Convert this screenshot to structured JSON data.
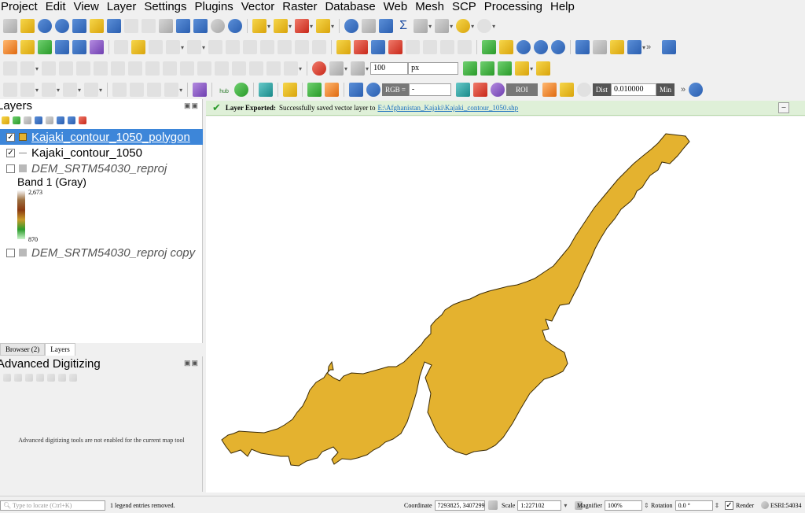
{
  "menu": [
    "Project",
    "Edit",
    "View",
    "Layer",
    "Settings",
    "Plugins",
    "Vector",
    "Raster",
    "Database",
    "Web",
    "Mesh",
    "SCP",
    "Processing",
    "Help"
  ],
  "toolbar3": {
    "buffer_value": "100",
    "unit": "px"
  },
  "toolbar4": {
    "hub_label": "hub",
    "rgb_label": "RGB =",
    "rgb_value": "-",
    "roi_label": "ROI",
    "dist_label": "Dist",
    "dist_value": "0.010000",
    "min_label": "Min"
  },
  "layers_panel": {
    "title": "Layers",
    "layers": [
      {
        "name": "Kajaki_contour_1050_polygon",
        "checked": true,
        "selected": true,
        "symbol": "polygon"
      },
      {
        "name": "Kajaki_contour_1050",
        "checked": true,
        "selected": false,
        "symbol": "line"
      },
      {
        "name": "DEM_SRTM54030_reproj",
        "checked": false,
        "selected": false,
        "symbol": "raster"
      },
      {
        "name": "DEM_SRTM54030_reproj copy",
        "checked": false,
        "selected": false,
        "symbol": "raster"
      }
    ],
    "band_label": "Band 1 (Gray)",
    "ramp_max": "2,673",
    "ramp_min": "870"
  },
  "tabs": [
    "Browser (2)",
    "Layers"
  ],
  "advanced_digitizing": {
    "title": "Advanced Digitizing",
    "message": "Advanced digitizing tools are not enabled for the current map tool"
  },
  "message_bar": {
    "title": "Layer Exported:",
    "text": "Successfully saved vector layer to",
    "link": "E:\\Afghanistan_Kajaki\\Kajaki_contour_1050.shp",
    "status_color": "#dff0d8"
  },
  "map": {
    "polygon_fill": "#e4b22f",
    "polygon_stroke": "#3a2a05"
  },
  "status": {
    "locate_placeholder": "Type to locate (Ctrl+K)",
    "legend_msg": "1 legend entries removed.",
    "coordinate_label": "Coordinate",
    "coordinate_value": "7293825, 3407299",
    "scale_label": "Scale",
    "scale_value": "1:227102",
    "magnifier_label": "Magnifier",
    "magnifier_value": "100%",
    "rotation_label": "Rotation",
    "rotation_value": "0.0 °",
    "render_label": "Render",
    "crs_label": "ESRI:54034"
  }
}
